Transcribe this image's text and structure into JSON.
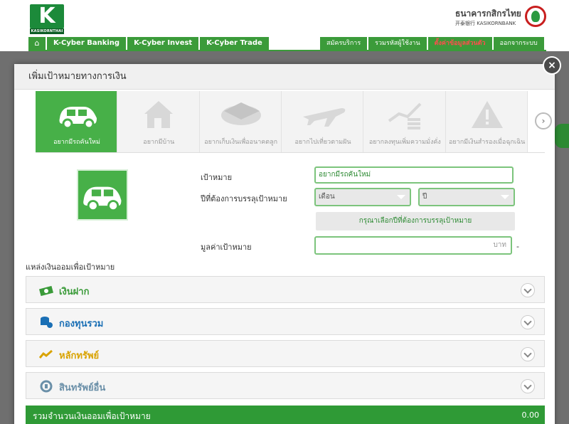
{
  "header": {
    "logo_text": "KASIKORNTHAI",
    "bank_name_th": "ธนาคารกสิกรไทย",
    "bank_name_en": "开泰银行 KASIKORNBANK",
    "nav_tabs": [
      "K-Cyber Banking",
      "K-Cyber Invest",
      "K-Cyber Trade"
    ],
    "right_tabs": [
      "สมัครบริการ",
      "รวมรหัสผู้ใช้งาน",
      "ตั้งค่าข้อมูลส่วนตัว",
      "ออกจากระบบ"
    ],
    "active_right_tab": "ตั้งค่าข้อมูลส่วนตัว",
    "brand_color": "#3b9b3a",
    "active_tab_color": "#ff4d4d"
  },
  "modal": {
    "title": "เพิ่มเป้าหมายทางการเงิน",
    "close_label": "×",
    "next_label": "›",
    "categories": [
      {
        "label": "อยากมีรถคันใหม่",
        "icon": "car-icon",
        "active": true
      },
      {
        "label": "อยากมีบ้าน",
        "icon": "house-icon",
        "active": false
      },
      {
        "label": "อยากเก็บเงินเพื่ออนาคตลูก",
        "icon": "graduation-cap-icon",
        "active": false
      },
      {
        "label": "อยากไปเที่ยวตามฝัน",
        "icon": "airplane-icon",
        "active": false
      },
      {
        "label": "อยากลงทุนเพิ่มความมั่งคั่ง",
        "icon": "growth-chart-icon",
        "active": false
      },
      {
        "label": "อยากมีเงินสำรองเมื่อฉุกเฉิน",
        "icon": "warning-icon",
        "active": false
      }
    ],
    "form": {
      "goal_label": "เป้าหมาย",
      "goal_value": "อยากมีรถคันใหม่",
      "target_year_label": "ปีที่ต้องการบรรลุเป้าหมาย",
      "month_placeholder": "เดือน",
      "year_placeholder": "ปี",
      "year_note": "กรุณาเลือกปีที่ต้องการบรรลุเป้าหมาย",
      "amount_label": "มูลค่าเป้าหมาย",
      "amount_unit": "บาท",
      "amount_suffix": "-"
    },
    "savings_sources_label": "แหล่งเงินออมเพื่อเป้าหมาย",
    "sources": [
      {
        "name": "เงินฝาก",
        "icon": "money-icon",
        "color": "#3b9b3a"
      },
      {
        "name": "กองทุนรวม",
        "icon": "coins-icon",
        "color": "#1a6fb5"
      },
      {
        "name": "หลักทรัพย์",
        "icon": "chart-icon",
        "color": "#d9a300"
      },
      {
        "name": "สินทรัพย์อื่น",
        "icon": "refresh-icon",
        "color": "#6a8fa8"
      }
    ],
    "total_label": "รวมจำนวนเงินออมเพื่อเป้าหมาย",
    "total_value": "0.00"
  }
}
